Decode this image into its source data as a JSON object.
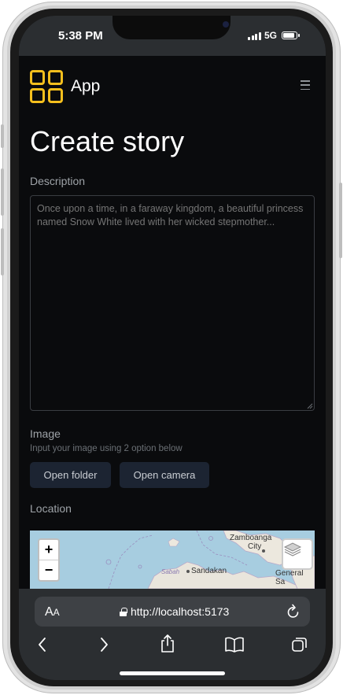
{
  "status_bar": {
    "time": "5:38 PM",
    "network": "5G"
  },
  "header": {
    "app_name": "App",
    "logo_icon": "grid-logo-icon",
    "menu_icon": "hamburger-menu-icon"
  },
  "page": {
    "title": "Create story"
  },
  "description": {
    "label": "Description",
    "placeholder": "Once upon a time, in a faraway kingdom, a beautiful princess named Snow White lived with her wicked stepmother..."
  },
  "image": {
    "label": "Image",
    "hint": "Input your image using 2 option below",
    "open_folder_label": "Open folder",
    "open_camera_label": "Open camera"
  },
  "location": {
    "label": "Location",
    "map": {
      "zoom_in": "+",
      "zoom_out": "−",
      "labels": [
        "Zamboanga",
        "City",
        "Sabah",
        "Sandakan",
        "General Sa"
      ]
    }
  },
  "browser": {
    "aa_label_big": "A",
    "aa_label_small": "A",
    "url": "http://localhost:5173"
  },
  "colors": {
    "accent": "#f5bf1d",
    "background": "#0a0b0d",
    "button": "#1c2432",
    "map_water": "#a7cde0"
  }
}
